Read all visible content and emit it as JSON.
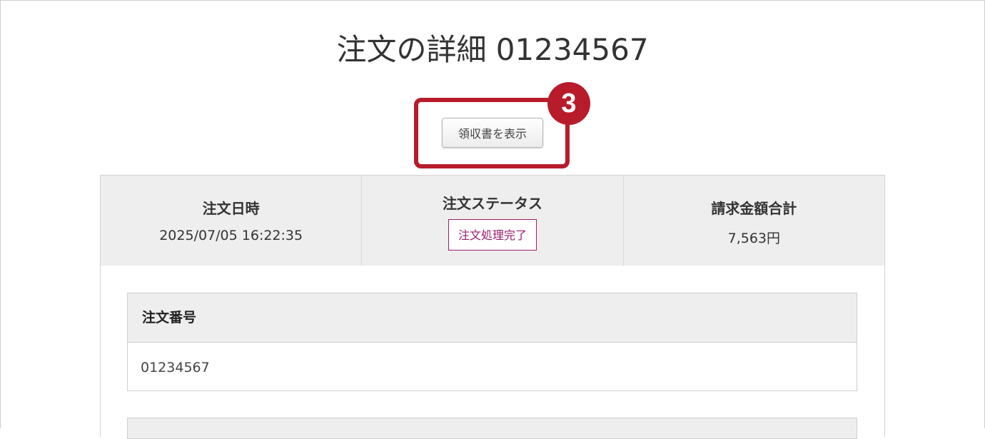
{
  "page": {
    "title": "注文の詳細 01234567"
  },
  "receipt": {
    "button_label": "領収書を表示",
    "step_number": "3",
    "highlight_color": "#b81c2a"
  },
  "summary": {
    "date": {
      "label": "注文日時",
      "value": "2025/07/05 16:22:35"
    },
    "status": {
      "label": "注文ステータス",
      "value": "注文処理完了",
      "color": "#9b1b6e"
    },
    "total": {
      "label": "請求金額合計",
      "value": "7,563円"
    }
  },
  "order": {
    "number_label": "注文番号",
    "number_value": "01234567"
  }
}
